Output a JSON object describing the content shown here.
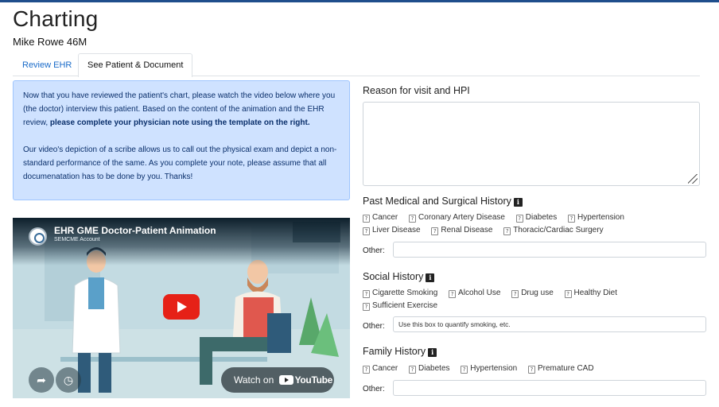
{
  "page": {
    "title": "Charting",
    "patient": "Mike Rowe 46M"
  },
  "tabs": [
    {
      "label": "Review EHR",
      "active": false
    },
    {
      "label": "See Patient & Document",
      "active": true
    }
  ],
  "info": {
    "p1_start": "Now that you have reviewed the patient's chart, please watch the video below where you (the doctor) interview this patient. Based on the content of the animation and the EHR review, ",
    "p1_bold": "please complete your physician note using the template on the right.",
    "p2": "Our video's depiction of a scribe allows us to call out the physical exam and depict a non-standard performance of the same. As you complete your note, please assume that all documenatation has to be done by you. Thanks!"
  },
  "video": {
    "title": "EHR GME Doctor-Patient Animation",
    "channel": "SEMCME Account",
    "watch_on": "Watch on",
    "youtube": "YouTube",
    "share_icon": "share-icon",
    "clock_icon": "clock-icon"
  },
  "hpi": {
    "label": "Reason for visit and HPI",
    "value": ""
  },
  "pmh": {
    "label": "Past Medical and Surgical History",
    "items_row1": [
      "Cancer",
      "Coronary Artery Disease",
      "Diabetes",
      "Hypertension"
    ],
    "items_row2": [
      "Liver Disease",
      "Renal Disease",
      "Thoracic/Cardiac Surgery"
    ],
    "other_label": "Other:",
    "other_value": ""
  },
  "social": {
    "label": "Social History",
    "items_row1": [
      "Cigarette Smoking",
      "Alcohol Use",
      "Drug use",
      "Healthy Diet"
    ],
    "items_row2": [
      "Sufficient Exercise"
    ],
    "other_label": "Other:",
    "other_value": "Use this box to quantify smoking, etc."
  },
  "family": {
    "label": "Family History",
    "items_row1": [
      "Cancer",
      "Diabetes",
      "Hypertension",
      "Premature CAD"
    ],
    "other_label": "Other:",
    "other_value": ""
  },
  "colors": {
    "info_bg": "#cfe2ff",
    "link": "#1a6bc9",
    "topbar": "#1f4e8c",
    "play": "#e62117"
  }
}
